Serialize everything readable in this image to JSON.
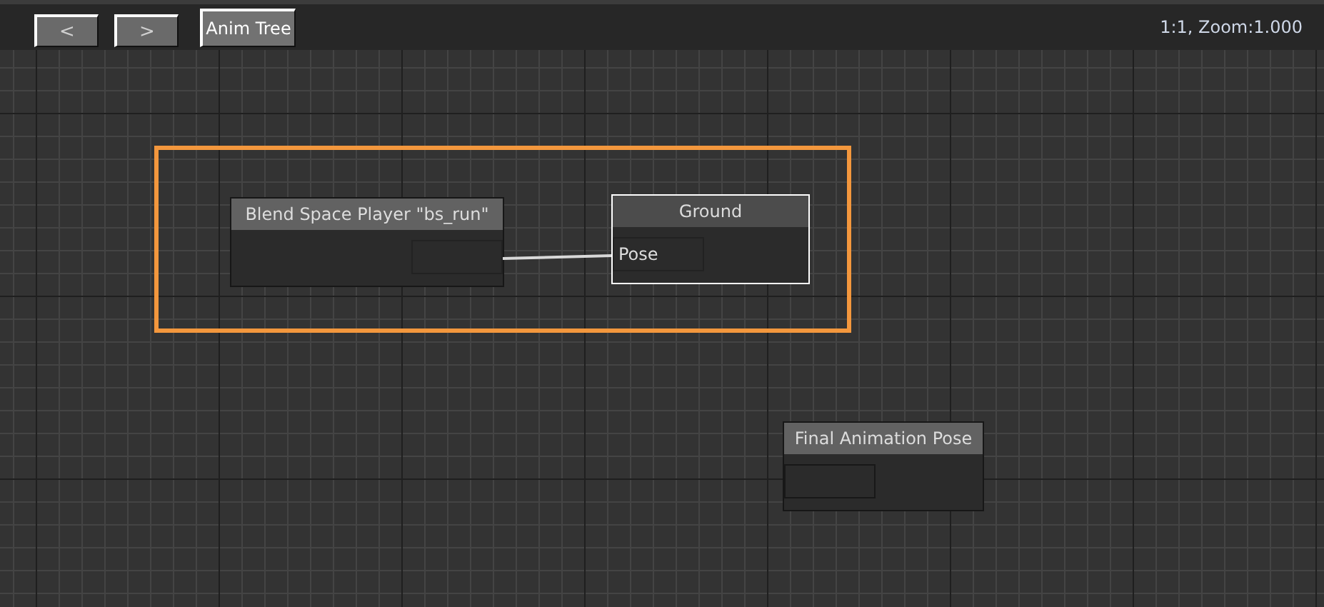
{
  "toolbar": {
    "buttons": [
      {
        "label": "<",
        "disabled": true
      },
      {
        "label": ">",
        "disabled": true
      },
      {
        "label": "Anim Tree",
        "disabled": false
      }
    ],
    "zoom_label": "1:1, Zoom:1.000"
  },
  "canvas": {
    "nodes": [
      {
        "title": "Blend Space Player \"bs_run\"",
        "selected": false,
        "slots": [
          {
            "kind": "output",
            "connected": true
          }
        ]
      },
      {
        "title": "Ground",
        "selected": true,
        "slots": [
          {
            "kind": "input",
            "label": "Pose",
            "connected": true
          }
        ]
      },
      {
        "title": "Final Animation Pose",
        "selected": false,
        "slots": [
          {
            "kind": "input"
          }
        ]
      }
    ],
    "selection_box": {
      "visible": true
    }
  }
}
